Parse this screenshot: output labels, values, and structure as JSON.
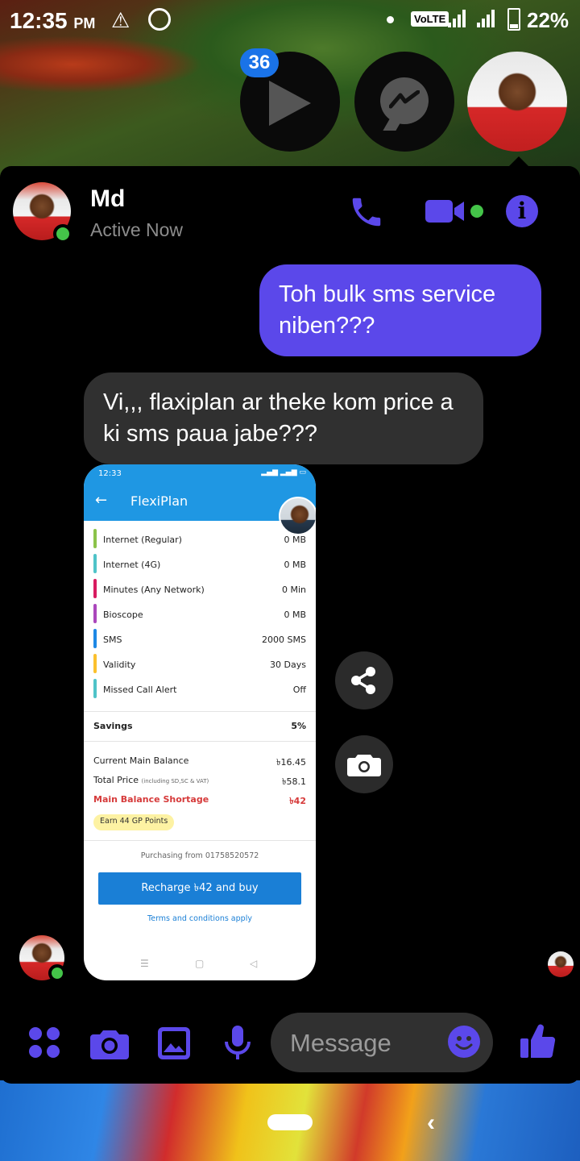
{
  "status_bar": {
    "time": "12:35",
    "ampm": "PM",
    "network": "VoLTE",
    "battery": "22%"
  },
  "chat_heads": {
    "badge_count": "36"
  },
  "header": {
    "name": "Md",
    "status": "Active Now"
  },
  "messages": [
    {
      "direction": "outgoing",
      "text": "Toh bulk sms service niben???"
    },
    {
      "direction": "incoming",
      "text": "Vi,,, flaxiplan ar theke kom price a ki sms paua jabe???"
    }
  ],
  "shared_image": {
    "status_time": "12:33",
    "title": "FlexiPlan",
    "rows": [
      {
        "label": "Internet (Regular)",
        "value": "0 MB",
        "color": "#8bc34a"
      },
      {
        "label": "Internet (4G)",
        "value": "0 MB",
        "color": "#4fc3c8"
      },
      {
        "label": "Minutes (Any Network)",
        "value": "0 Min",
        "color": "#d81b60"
      },
      {
        "label": "Bioscope",
        "value": "0 MB",
        "color": "#ab47bc"
      },
      {
        "label": "SMS",
        "value": "2000 SMS",
        "color": "#1e88e5"
      },
      {
        "label": "Validity",
        "value": "30 Days",
        "color": "#fbc02d"
      },
      {
        "label": "Missed Call Alert",
        "value": "Off",
        "color": "#4fc3c8"
      }
    ],
    "savings_label": "Savings",
    "savings_value": "5%",
    "current_balance_label": "Current Main Balance",
    "current_balance_value": "৳16.45",
    "total_price_label": "Total Price",
    "total_price_note": "(including SD,SC & VAT)",
    "total_price_value": "৳58.1",
    "shortage_label": "Main Balance Shortage",
    "shortage_value": "৳42",
    "points_label": "Earn 44 GP Points",
    "purchasing_from": "Purchasing from 01758520572",
    "recharge_button": "Recharge ৳42 and buy",
    "terms": "Terms and conditions apply"
  },
  "composer": {
    "placeholder": "Message"
  },
  "icons": [
    "warning-icon",
    "messenger-icon",
    "play-icon",
    "phone-icon",
    "video-icon",
    "info-icon",
    "share-icon",
    "camera-icon",
    "apps-icon",
    "gallery-icon",
    "mic-icon",
    "emoji-icon",
    "like-icon"
  ],
  "colors": {
    "accent": "#5b48ea",
    "online": "#44c449",
    "incoming_bubble": "#303030",
    "badge": "#1a73e8"
  }
}
